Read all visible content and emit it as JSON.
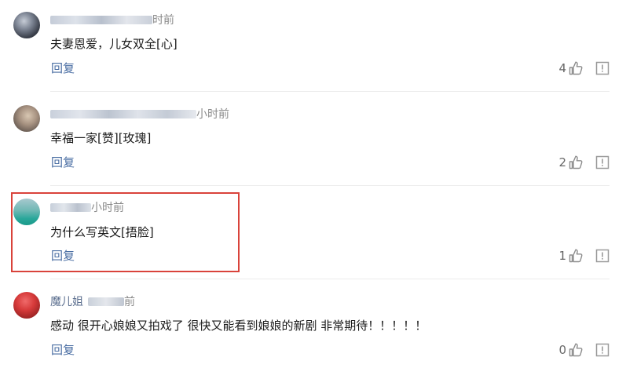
{
  "colors": {
    "meta_text": "#8a8a8a",
    "reply_link": "#4a6ea3",
    "highlight_border": "#d9433b"
  },
  "reply_label": "回复",
  "comments": [
    {
      "time": "时前",
      "text": "夫妻恩爱，儿女双全[心]",
      "likes": "4"
    },
    {
      "time": "小时前",
      "text": "幸福一家[赞][玫瑰]",
      "likes": "2"
    },
    {
      "time": "小时前",
      "text": "为什么写英文[捂脸]",
      "likes": "1"
    },
    {
      "name_visible": "魔儿姐",
      "time": "前",
      "text": "感动 很开心娘娘又拍戏了 很快又能看到娘娘的新剧 非常期待！！！！！",
      "likes": "0"
    }
  ],
  "icons": {
    "like": "thumbs-up-icon",
    "report": "report-icon"
  }
}
